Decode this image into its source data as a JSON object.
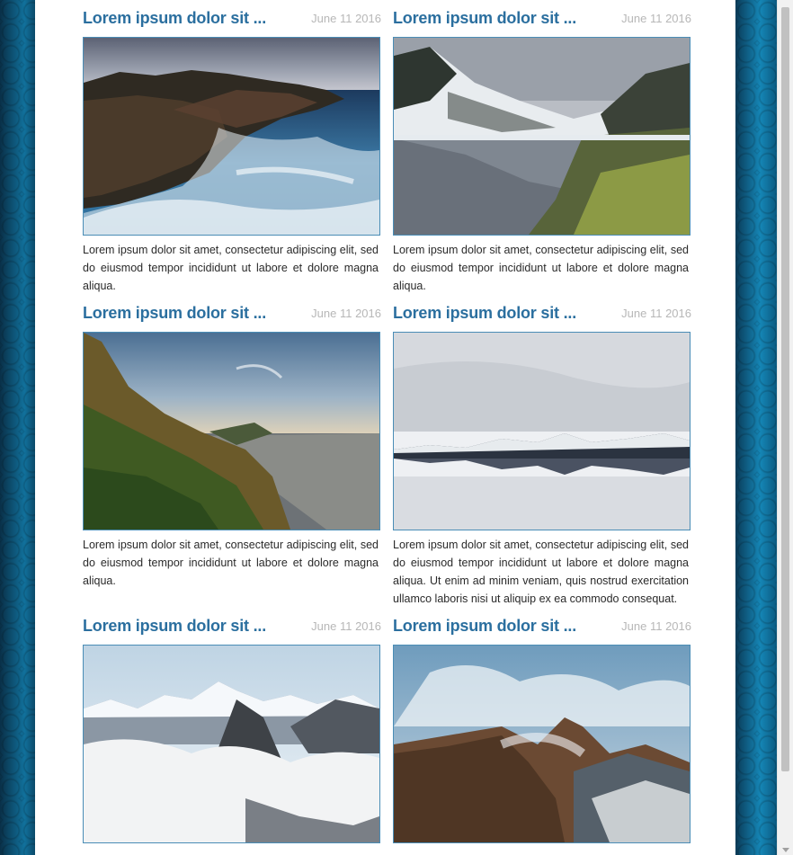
{
  "posts": [
    {
      "title": "Lorem ipsum dolor sit ...",
      "date": "June 11 2016",
      "image": "rocky-coast-waves",
      "text": "Lorem ipsum dolor sit amet, consectetur adipiscing elit, sed do eiusmod tempor incididunt ut labore et dolore magna aliqua."
    },
    {
      "title": "Lorem ipsum dolor sit ...",
      "date": "June 11 2016",
      "image": "snowy-mountain-lake",
      "text": "Lorem ipsum dolor sit amet, consectetur adipiscing elit, sed do eiusmod tempor incididunt ut labore et dolore magna aliqua."
    },
    {
      "title": "Lorem ipsum dolor sit ...",
      "date": "June 11 2016",
      "image": "coastal-cliffs-sunset",
      "text": "Lorem ipsum dolor sit amet, consectetur adipiscing elit, sed do eiusmod tempor incididunt ut labore et dolore magna aliqua."
    },
    {
      "title": "Lorem ipsum dolor sit ...",
      "date": "June 11 2016",
      "image": "mountain-reflection-lake",
      "text": "Lorem ipsum dolor sit amet, consectetur adipiscing elit, sed do eiusmod tempor incididunt ut labore et dolore magna aliqua. Ut enim ad minim veniam, quis nostrud exercitation ullamco laboris nisi ut aliquip ex ea commodo consequat."
    },
    {
      "title": "Lorem ipsum dolor sit ...",
      "date": "June 11 2016",
      "image": "peaks-above-clouds",
      "text": ""
    },
    {
      "title": "Lorem ipsum dolor sit ...",
      "date": "June 11 2016",
      "image": "rocky-mountains-mist",
      "text": ""
    }
  ]
}
